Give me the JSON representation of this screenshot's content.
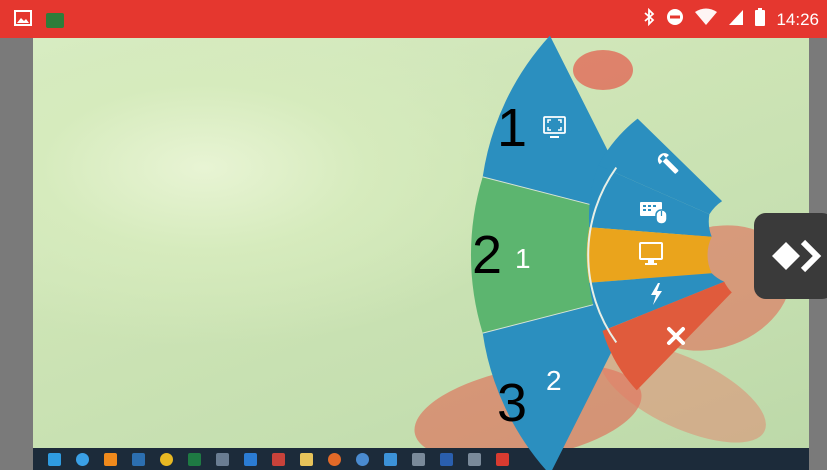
{
  "status_bar": {
    "time": "14:26",
    "left_icons": [
      "gallery-icon",
      "app-thumbnail-icon"
    ],
    "right_icons": [
      "bluetooth-icon",
      "do-not-disturb-icon",
      "wifi-icon",
      "signal-icon",
      "battery-icon"
    ],
    "color": "#e5372f"
  },
  "radial_menu": {
    "main_segments": [
      {
        "number": "1",
        "icon": "fullscreen-monitor-icon",
        "color": "#2b8fbf"
      },
      {
        "number": "2",
        "sub_number": "1",
        "color": "#5cb56f"
      },
      {
        "number": "3",
        "sub_number": "2",
        "color": "#2b8fbf"
      }
    ],
    "sub_segments": [
      {
        "icon": "wrench-icon",
        "color": "#2b8fbf"
      },
      {
        "icon": "keyboard-mouse-icon",
        "color": "#2b8fbf"
      },
      {
        "icon": "monitor-icon",
        "color": "#eaa41c"
      },
      {
        "icon": "lightning-icon",
        "color": "#2b8fbf"
      },
      {
        "icon": "close-icon",
        "color": "#e05b3c"
      }
    ]
  },
  "edge_handle": {
    "icon": "diamond-chevron-icon"
  },
  "taskbar": {
    "icons": [
      "start-icon",
      "edge-icon",
      "vlc-icon",
      "app-icon",
      "chrome-icon",
      "excel-icon",
      "app-icon",
      "app-icon",
      "app-icon",
      "folder-icon",
      "firefox-icon",
      "app-icon",
      "app-icon",
      "tools-icon",
      "word-icon",
      "tools-icon",
      "app-icon"
    ]
  }
}
